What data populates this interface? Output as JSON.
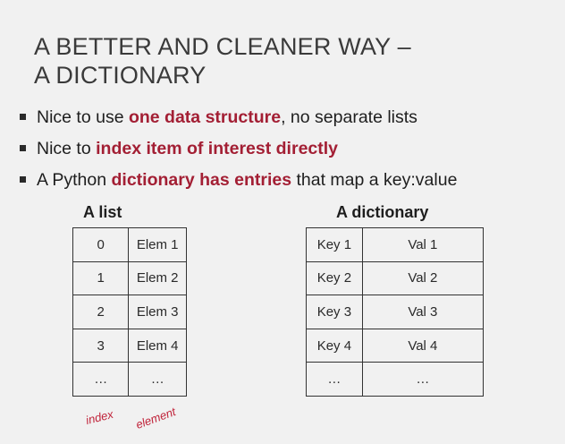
{
  "title": {
    "line1": "A BETTER AND CLEANER WAY –",
    "line2": "A DICTIONARY"
  },
  "bullets": [
    {
      "pre": "Nice to use ",
      "bold": "one data structure",
      "post": ", no separate lists"
    },
    {
      "pre": "Nice to ",
      "bold": "index item of interest directly",
      "post": ""
    },
    {
      "pre": "A Python ",
      "bold": "dictionary has entries",
      "post": " that map a key:value"
    }
  ],
  "list_table": {
    "title": "A list",
    "rows": [
      [
        "0",
        "Elem 1"
      ],
      [
        "1",
        "Elem 2"
      ],
      [
        "2",
        "Elem 3"
      ],
      [
        "3",
        "Elem 4"
      ],
      [
        "…",
        "…"
      ]
    ]
  },
  "dict_table": {
    "title": "A dictionary",
    "rows": [
      [
        "Key 1",
        "Val 1"
      ],
      [
        "Key 2",
        "Val 2"
      ],
      [
        "Key 3",
        "Val 3"
      ],
      [
        "Key 4",
        "Val 4"
      ],
      [
        "…",
        "…"
      ]
    ]
  },
  "annotations": {
    "index": "index",
    "element": "element"
  },
  "colors": {
    "accent": "#a31f34",
    "annotation": "#c0233a"
  }
}
